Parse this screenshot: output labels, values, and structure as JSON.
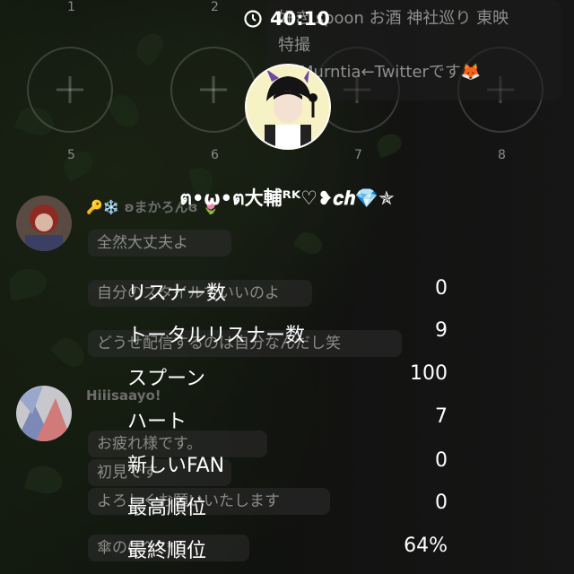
{
  "timer": {
    "icon": "clock-icon",
    "time": "40:10"
  },
  "host": {
    "name": "ต•ω•ต大輔ᴿᴷ♡❥𝒄𝒉💎✯"
  },
  "slots": {
    "top_numbers": [
      "1",
      "2"
    ],
    "bottom_numbers": [
      "5",
      "6",
      "7",
      "8"
    ]
  },
  "info_panel": {
    "line1": "好き spoon お酒 神社巡り 東映",
    "line2": "特撮",
    "line3": "Murntia←Twitterです🦊"
  },
  "chat": [
    {
      "name": "🔑❄️ ʚまかろんɞ 🌷",
      "messages": [
        "全然大丈夫よ",
        "自分のスタイルでいいのよ",
        "どうせ配信するのは自分なんだし笑"
      ]
    },
    {
      "name": "Hiiisaayo!",
      "messages": [
        "お疲れ様です。",
        "初見です",
        "よろしくお願いいたします",
        "傘の(*^^*)"
      ]
    }
  ],
  "stats": [
    {
      "label": "リスナー数",
      "value": "0"
    },
    {
      "label": "トータルリスナー数",
      "value": "9"
    },
    {
      "label": "スプーン",
      "value": "100"
    },
    {
      "label": "ハート",
      "value": "7"
    },
    {
      "label": "新しいFAN",
      "value": "0"
    },
    {
      "label": "最高順位",
      "value": "0"
    },
    {
      "label": "最終順位",
      "value": "64%"
    }
  ]
}
